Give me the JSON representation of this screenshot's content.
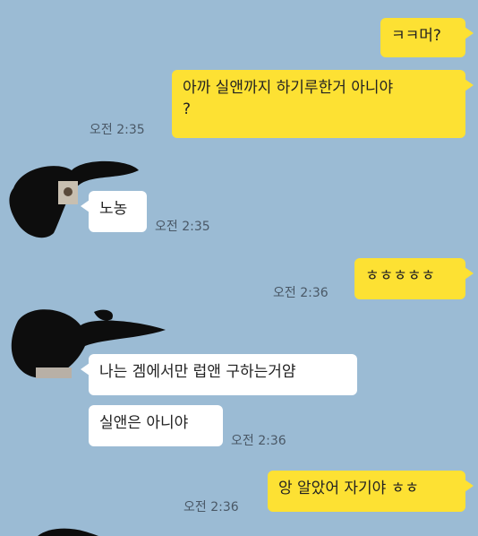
{
  "messages": [
    {
      "sender": "me",
      "text": "ㅋㅋ머?"
    },
    {
      "sender": "me",
      "text": "아까 실앤까지 하기루한거 아니야\n?",
      "time": "오전 2:35"
    },
    {
      "sender": "other",
      "text": "노농",
      "time": "오전 2:35"
    },
    {
      "sender": "me",
      "text": "ㅎㅎㅎㅎㅎ",
      "time": "오전 2:36"
    },
    {
      "sender": "other",
      "text": "나는 겜에서만 럽앤 구하는거얌"
    },
    {
      "sender": "other",
      "text": "실앤은 아니야",
      "time": "오전 2:36"
    },
    {
      "sender": "me",
      "text": "앙 알았어 자기야 ㅎㅎ",
      "time": "오전 2:36"
    }
  ],
  "colors": {
    "background": "#9bbbd4",
    "my_bubble": "#fde133",
    "other_bubble": "#ffffff"
  }
}
